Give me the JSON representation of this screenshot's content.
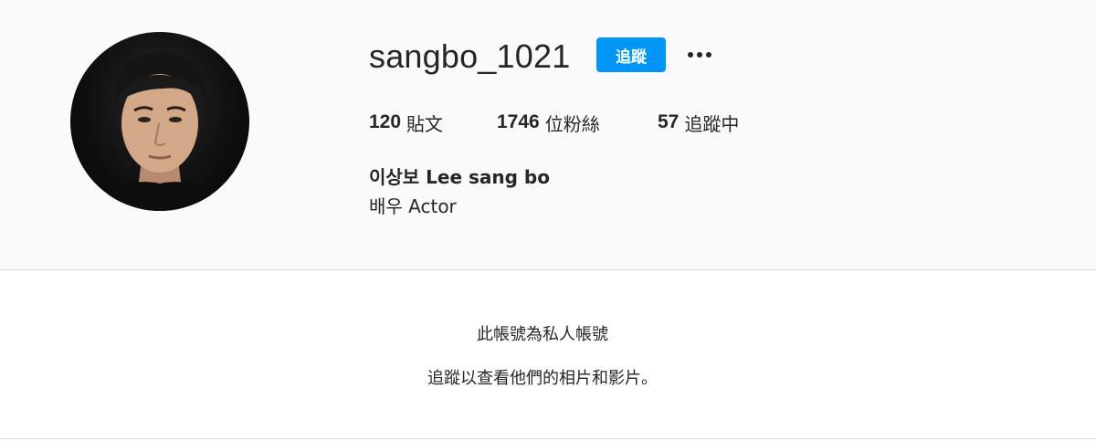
{
  "profile": {
    "username": "sangbo_1021",
    "follow_label": "追蹤",
    "more_icon": "more-horizontal-icon",
    "stats": {
      "posts_count": "120",
      "posts_label": "貼文",
      "followers_count": "1746",
      "followers_label": "位粉絲",
      "following_count": "57",
      "following_label": "追蹤中"
    },
    "full_name": "이상보 Lee sang bo",
    "bio": "배우 Actor"
  },
  "private_notice": {
    "title": "此帳號為私人帳號",
    "subtitle": "追蹤以查看他們的相片和影片。"
  },
  "colors": {
    "follow_button": "#0095f6",
    "header_background": "#fafafa",
    "divider": "#dbdbdb"
  }
}
